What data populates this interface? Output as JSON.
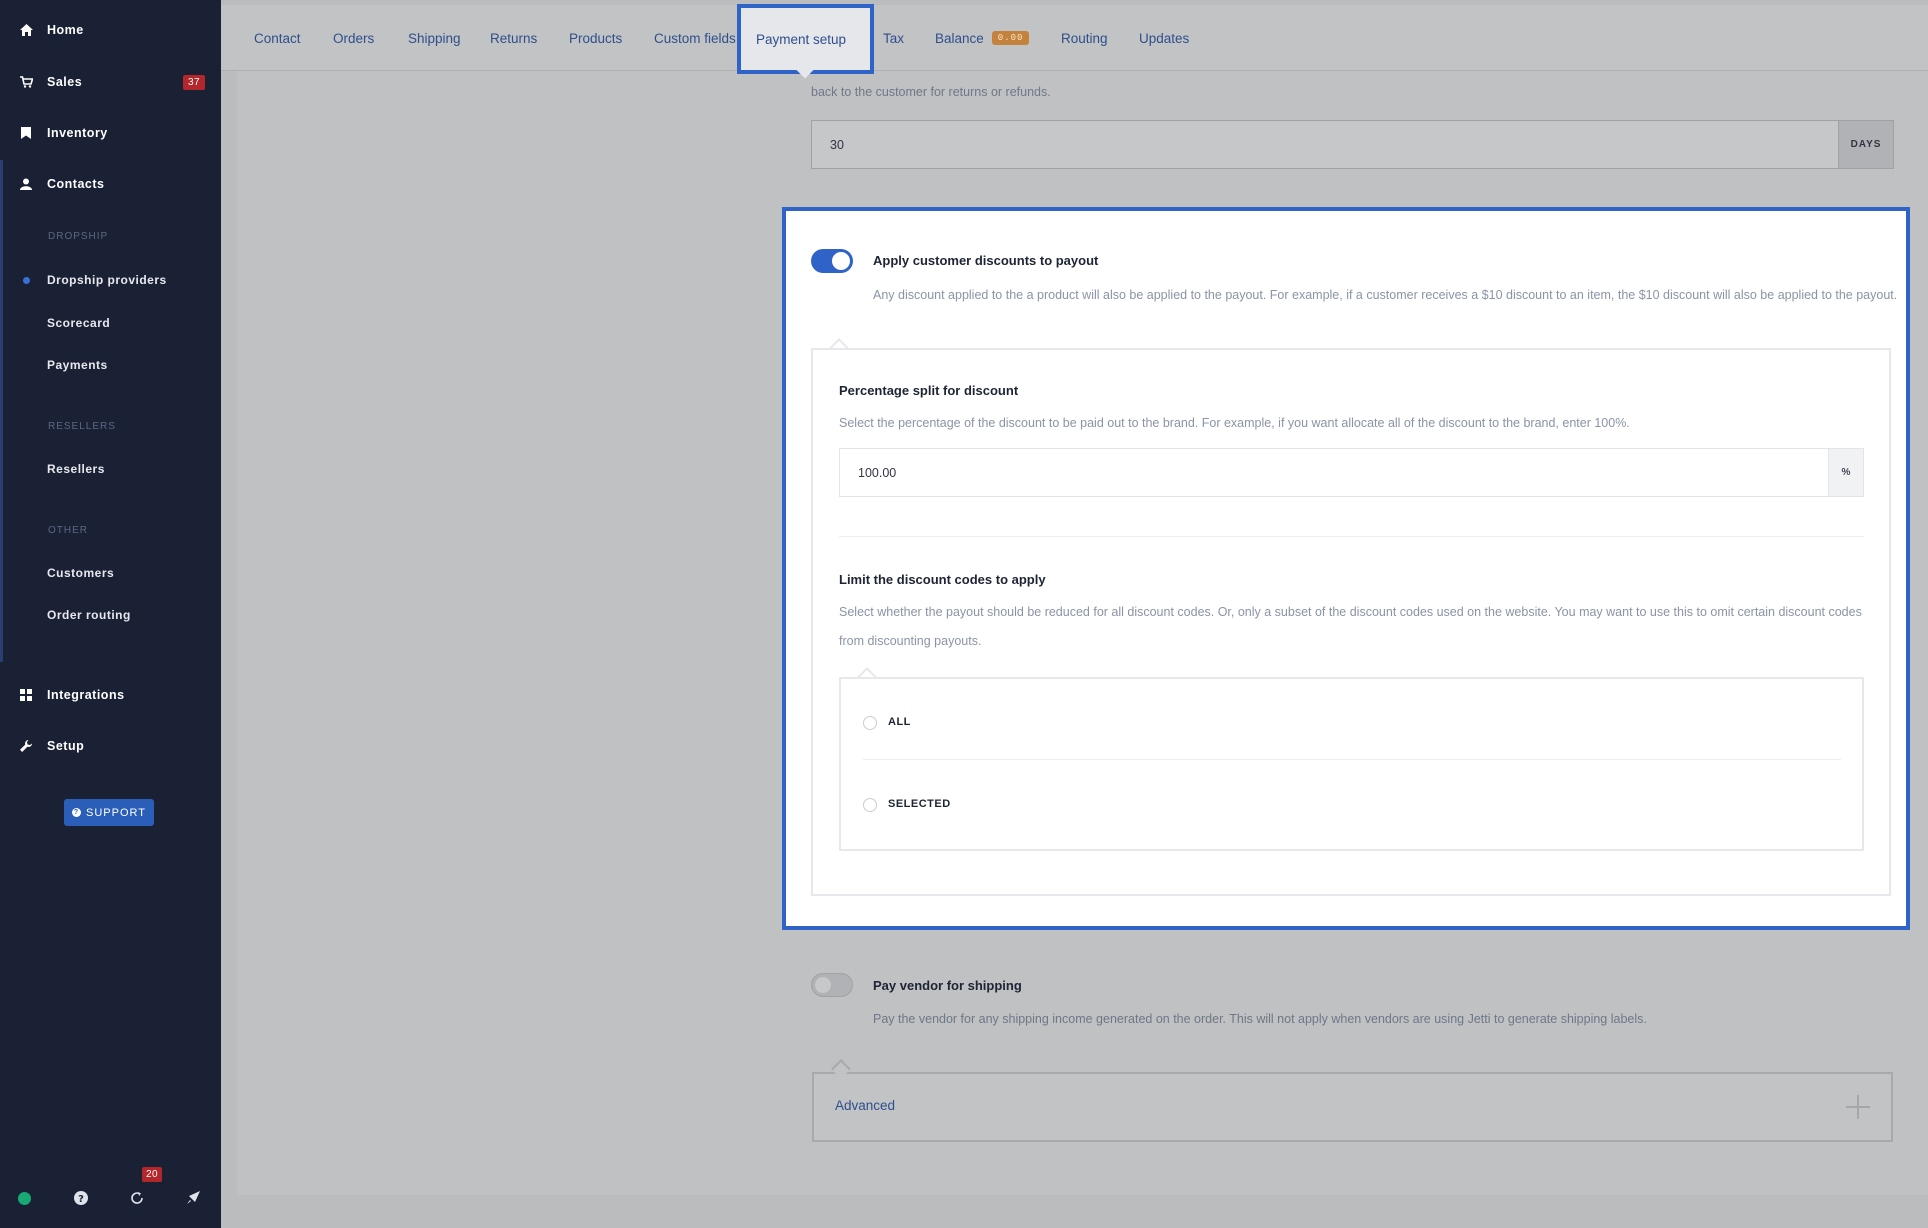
{
  "sidebar": {
    "nav": [
      {
        "label": "Home",
        "icon": "home-icon"
      },
      {
        "label": "Sales",
        "icon": "cart-icon",
        "badge": "37"
      },
      {
        "label": "Inventory",
        "icon": "bookmark-icon"
      },
      {
        "label": "Contacts",
        "icon": "user-icon"
      }
    ],
    "dropship_header": "DROPSHIP",
    "dropship_items": [
      "Dropship providers",
      "Scorecard",
      "Payments"
    ],
    "resellers_header": "RESELLERS",
    "resellers_items": [
      "Resellers"
    ],
    "other_header": "OTHER",
    "other_items": [
      "Customers",
      "Order routing"
    ],
    "bottom_nav": [
      {
        "label": "Integrations",
        "icon": "grid-icon"
      },
      {
        "label": "Setup",
        "icon": "wrench-icon"
      }
    ],
    "support_label": "SUPPORT",
    "footer_badge": "20"
  },
  "tabs": {
    "items": [
      "Contact",
      "Orders",
      "Shipping",
      "Returns",
      "Products",
      "Custom fields",
      "Payment setup",
      "Tax",
      "Balance",
      "Routing",
      "Updates"
    ],
    "active": "Payment setup",
    "balance_badge": "0.00"
  },
  "returns_section": {
    "description_tail": "back to the customer for returns or refunds.",
    "value": "30",
    "unit": "DAYS"
  },
  "discount_card": {
    "toggle_on": true,
    "title": "Apply customer discounts to payout",
    "description": "Any discount applied to the a product will also be applied to the payout. For example, if a customer receives a $10 discount to an item, the $10 discount will also be applied to the payout.",
    "split_title": "Percentage split for discount",
    "split_description": "Select the percentage of the discount to be paid out to the brand. For example, if you want allocate all of the discount to the brand, enter 100%.",
    "split_value": "100.00",
    "split_unit": "%",
    "limit_title": "Limit the discount codes to apply",
    "limit_description_line1": "Select whether the payout should be reduced for all discount codes. Or, only a subset of the discount codes used on the website. You may want to use this to omit certain discount codes",
    "limit_description_line2": "from discounting payouts.",
    "options": [
      "ALL",
      "SELECTED"
    ]
  },
  "shipping_section": {
    "toggle_on": false,
    "title": "Pay vendor for shipping",
    "description": "Pay the vendor for any shipping income generated on the order. This will not apply when vendors are using Jetti to generate shipping labels."
  },
  "advanced_label": "Advanced",
  "colors": {
    "sidebar_bg": "#1a2134",
    "accent_blue": "#2f63c7",
    "badge_red": "#b3262a",
    "balance_orange": "#c4823c",
    "status_green": "#19a974"
  }
}
